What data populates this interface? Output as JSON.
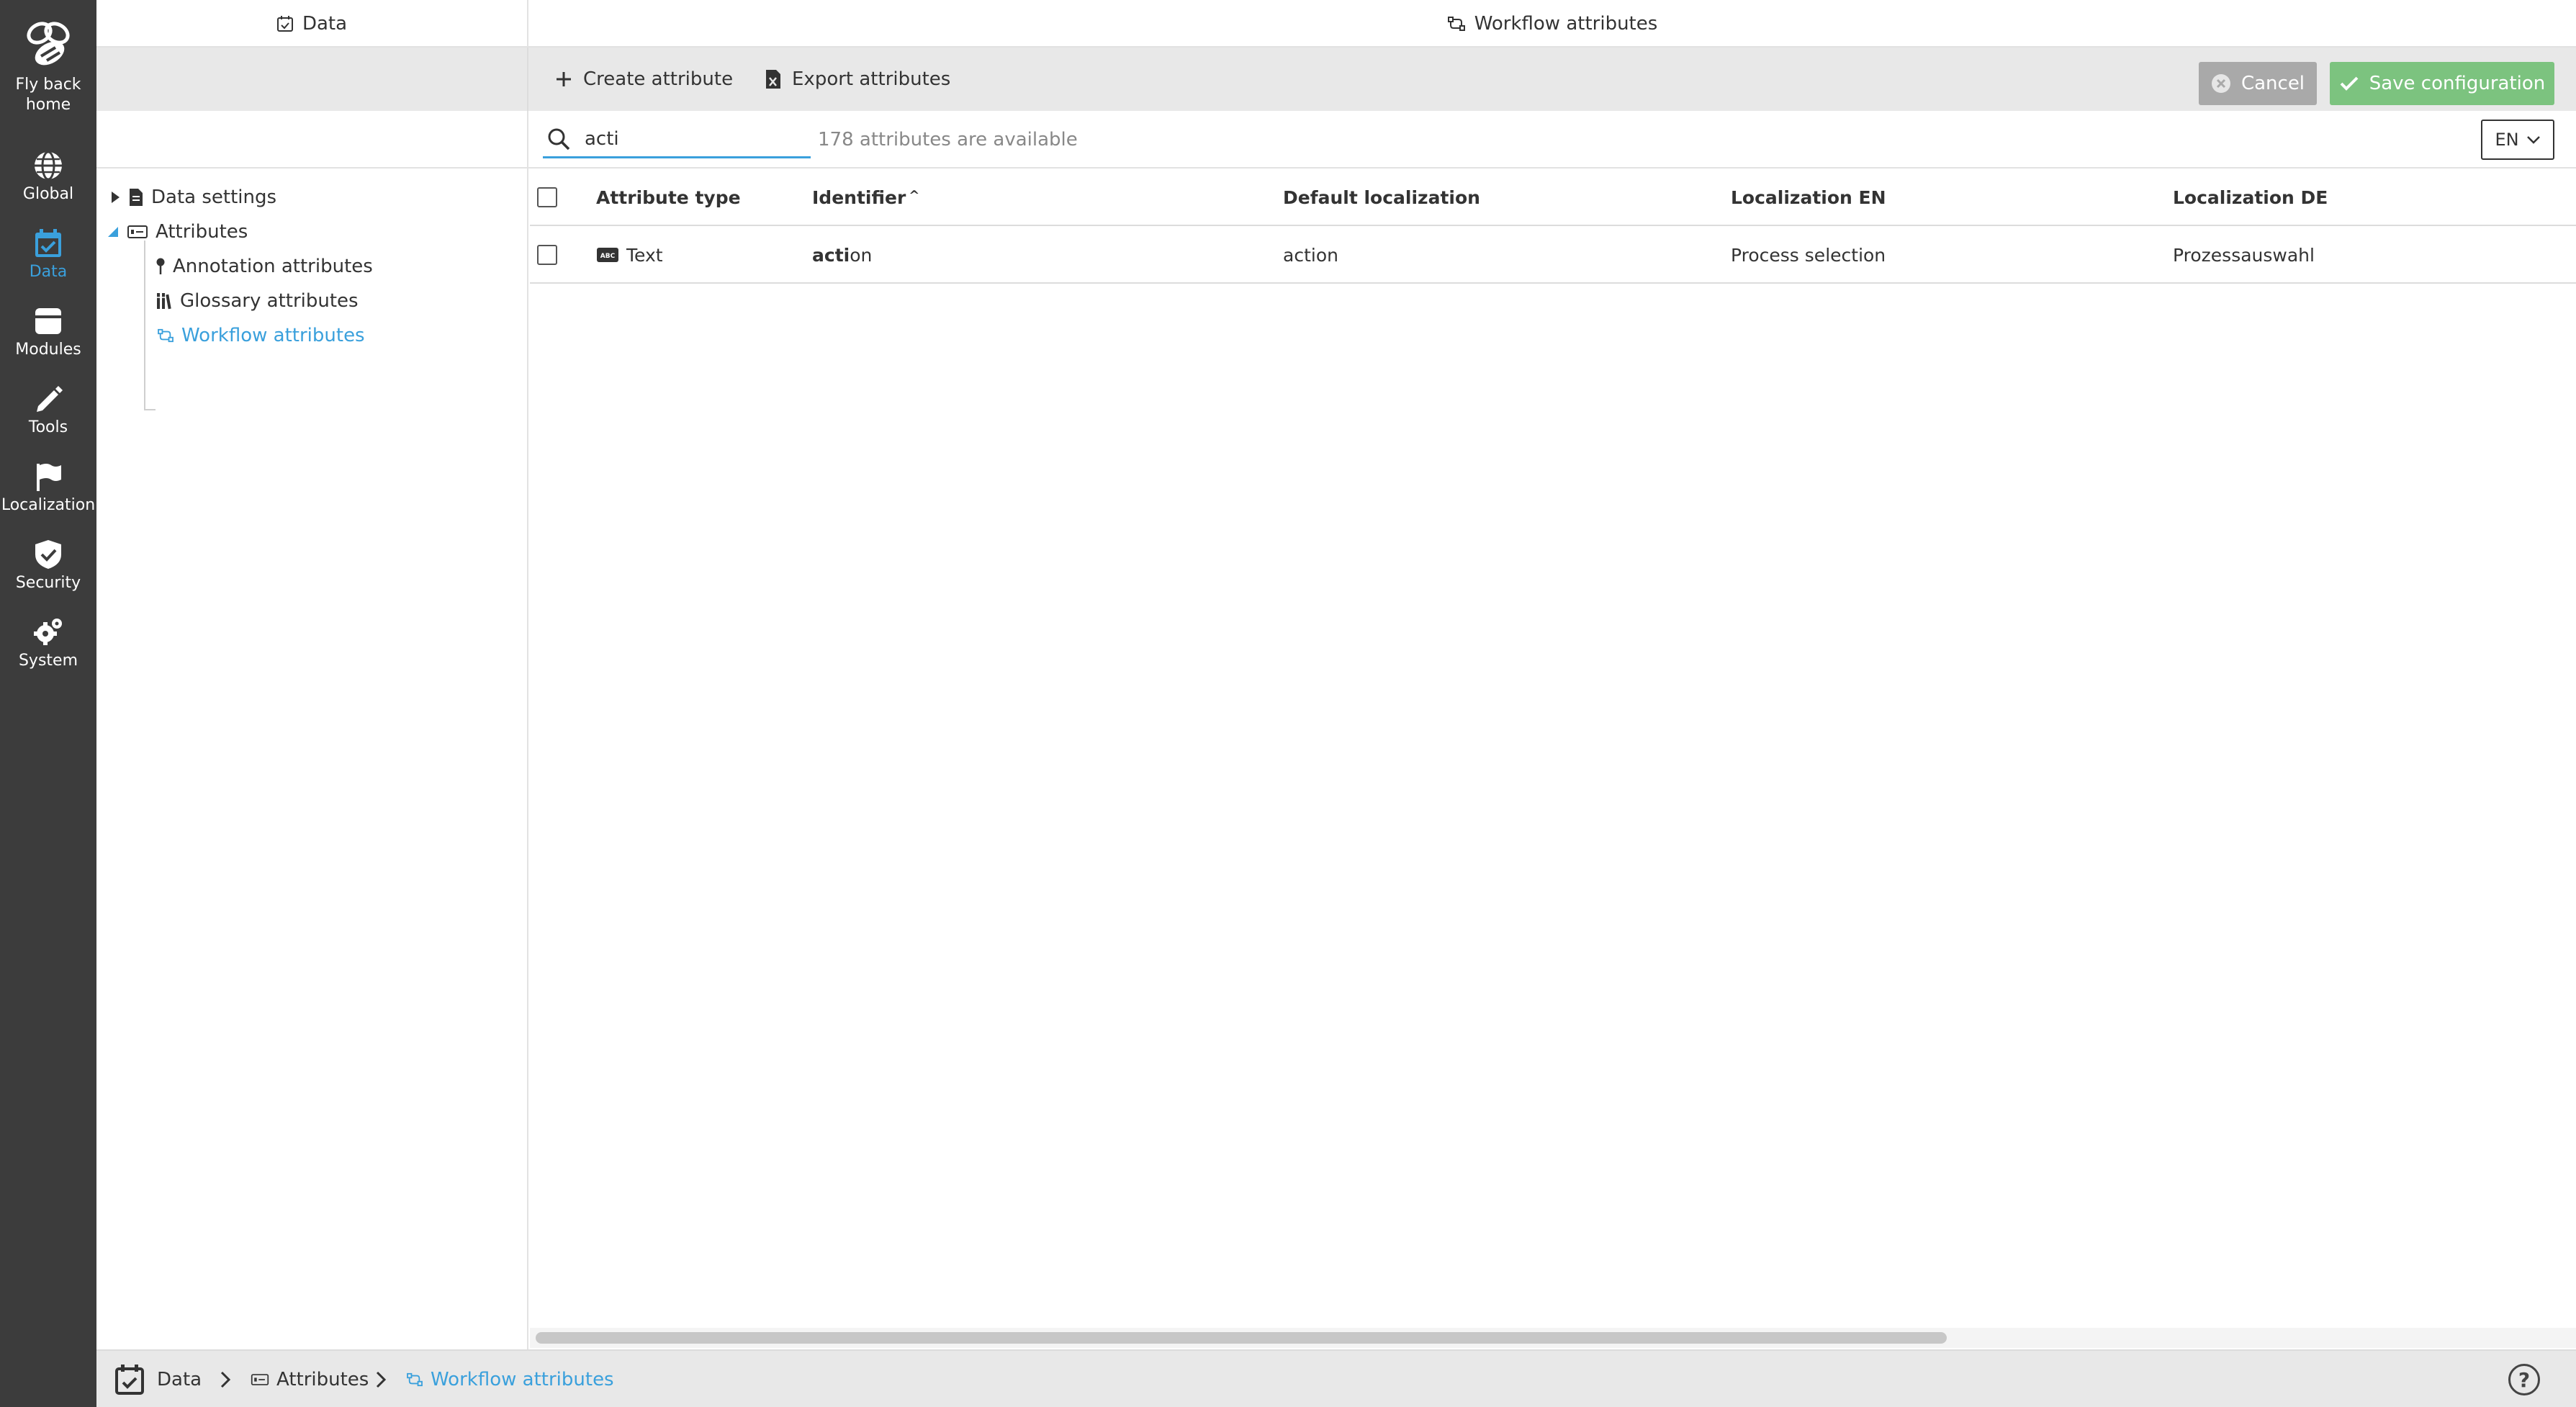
{
  "rail": {
    "home": "Fly back\nhome",
    "items": [
      {
        "label": "Global",
        "icon": "globe-icon"
      },
      {
        "label": "Data",
        "icon": "calendar-check-icon"
      },
      {
        "label": "Modules",
        "icon": "module-icon"
      },
      {
        "label": "Tools",
        "icon": "pencil-icon"
      },
      {
        "label": "Localization",
        "icon": "flag-icon"
      },
      {
        "label": "Security",
        "icon": "shield-check-icon"
      },
      {
        "label": "System",
        "icon": "cog-icon"
      }
    ],
    "active_color": "#3aa0dc"
  },
  "header": {
    "left_title": "Data",
    "right_title": "Workflow attributes"
  },
  "toolbar": {
    "create_label": "Create attribute",
    "export_label": "Export attributes",
    "cancel_label": "Cancel",
    "save_label": "Save configuration"
  },
  "search": {
    "value": "acti",
    "available_text": "178 attributes are available",
    "language": "EN"
  },
  "tree": {
    "items": [
      {
        "label": "Data settings"
      },
      {
        "label": "Attributes"
      },
      {
        "label": "Annotation attributes"
      },
      {
        "label": "Glossary attributes"
      },
      {
        "label": "Workflow attributes"
      }
    ]
  },
  "table": {
    "columns": [
      "Attribute type",
      "Identifier",
      "Default localization",
      "Localization EN",
      "Localization DE"
    ],
    "sort_indicator": "^",
    "rows": [
      {
        "type": "Text",
        "identifier_match": "acti",
        "identifier_rest": "on",
        "default_localization": "action",
        "localization_en": "Process selection",
        "localization_de": "Prozessauswahl"
      }
    ]
  },
  "breadcrumb": {
    "items": [
      "Data",
      "Attributes",
      "Workflow attributes"
    ]
  },
  "help_label": "?"
}
